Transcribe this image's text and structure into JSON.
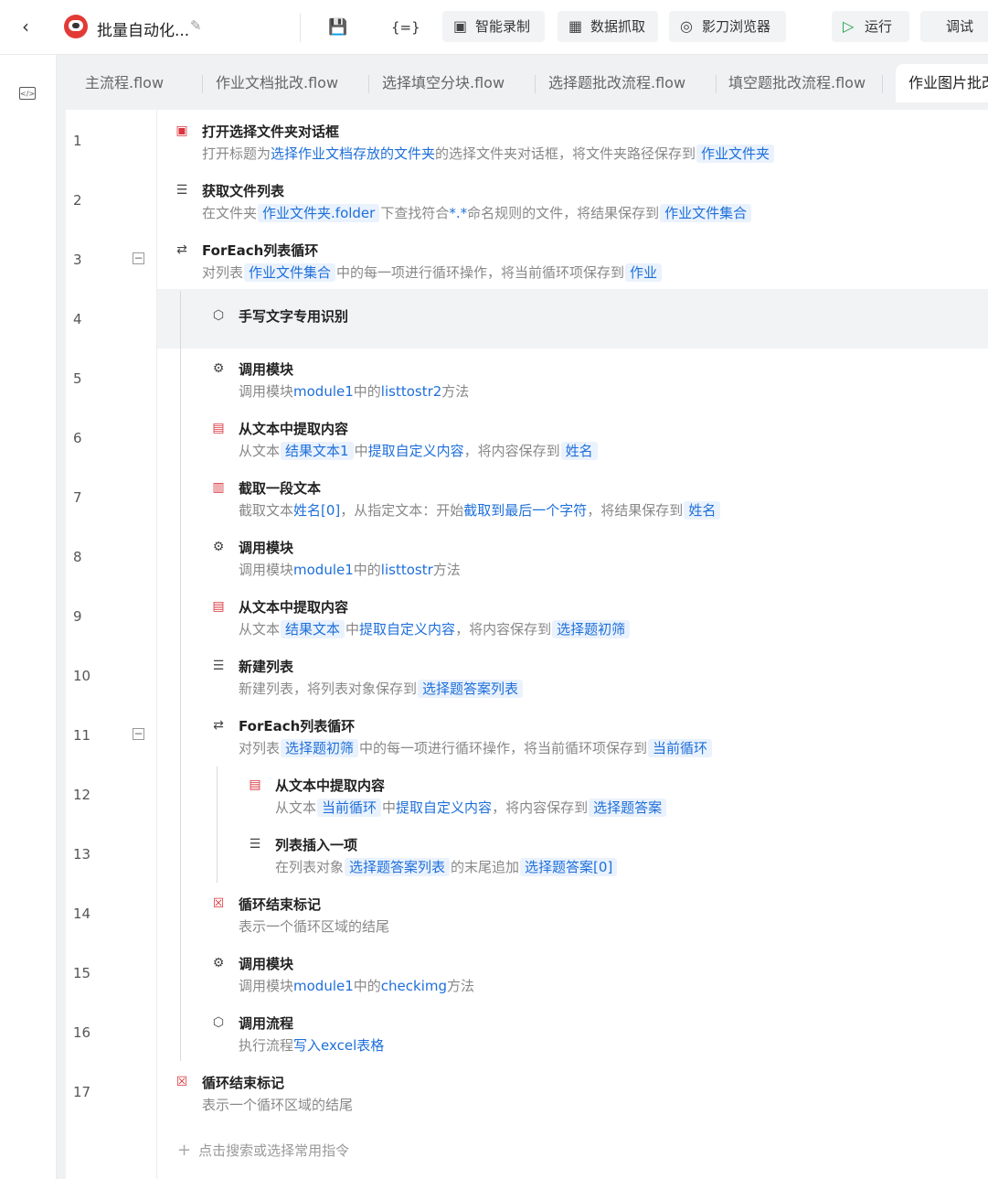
{
  "toolbar": {
    "back_icon": "chevron-left-icon",
    "project_title": "批量自动化...",
    "save_icon": "save-icon",
    "variables_icon": "variables-icon",
    "smart_record": "智能录制",
    "data_scrape": "数据抓取",
    "browser": "影刀浏览器",
    "run": "运行",
    "debug": "调试",
    "run_color": "#1aa34a"
  },
  "tabs": [
    "主流程.flow",
    "作业文档批改.flow",
    "选择填空分块.flow",
    "选择题批改流程.flow",
    "填空题批改流程.flow",
    "作业图片批改"
  ],
  "lines": [
    "1",
    "2",
    "3",
    "4",
    "5",
    "6",
    "7",
    "8",
    "9",
    "10",
    "11",
    "12",
    "13",
    "14",
    "15",
    "16",
    "17"
  ],
  "steps": [
    {
      "title": "打开选择文件夹对话框",
      "icon": "dialog-icon",
      "desc": [
        [
          "打开标题为",
          ""
        ],
        [
          "选择作业文档存放的文件夹",
          "kw"
        ],
        [
          "的选择文件夹对话框，将文件夹路径保存到",
          ""
        ],
        [
          "作业文件夹",
          "chip"
        ]
      ]
    },
    {
      "title": "获取文件列表",
      "icon": "file-list-icon",
      "desc": [
        [
          "在文件夹",
          ""
        ],
        [
          "作业文件夹.folder",
          "chip"
        ],
        [
          "下查找符合",
          ""
        ],
        [
          "*.*",
          "kw"
        ],
        [
          "命名规则的文件，将结果保存到",
          ""
        ],
        [
          "作业文件集合",
          "chip"
        ]
      ]
    },
    {
      "title": "ForEach列表循环",
      "icon": "loop-icon",
      "desc": [
        [
          "对列表",
          ""
        ],
        [
          "作业文件集合",
          "chip"
        ],
        [
          "中的每一项进行循环操作，将当前循环项保存到",
          ""
        ],
        [
          "作业",
          "chip"
        ]
      ]
    },
    {
      "title": "手写文字专用识别",
      "icon": "layers-icon",
      "desc": []
    },
    {
      "title": "调用模块",
      "icon": "module-icon",
      "desc": [
        [
          "调用模块",
          ""
        ],
        [
          "module1",
          "kw"
        ],
        [
          "中的",
          ""
        ],
        [
          "listtostr2",
          "kw"
        ],
        [
          "方法",
          ""
        ]
      ]
    },
    {
      "title": "从文本中提取内容",
      "icon": "extract-text-icon",
      "desc": [
        [
          "从文本",
          ""
        ],
        [
          "结果文本1",
          "chip"
        ],
        [
          "中",
          ""
        ],
        [
          "提取自定义内容",
          "kw"
        ],
        [
          "，将内容保存到",
          ""
        ],
        [
          "姓名",
          "chip"
        ]
      ]
    },
    {
      "title": "截取一段文本",
      "icon": "substring-icon",
      "desc": [
        [
          "截取文本",
          ""
        ],
        [
          "姓名[0]",
          "kw"
        ],
        [
          "，从指定文本：开始",
          ""
        ],
        [
          "截取到最后一个字符",
          "kw"
        ],
        [
          "，将结果保存到",
          ""
        ],
        [
          "姓名",
          "chip"
        ]
      ]
    },
    {
      "title": "调用模块",
      "icon": "module-icon",
      "desc": [
        [
          "调用模块",
          ""
        ],
        [
          "module1",
          "kw"
        ],
        [
          "中的",
          ""
        ],
        [
          "listtostr",
          "kw"
        ],
        [
          "方法",
          ""
        ]
      ]
    },
    {
      "title": "从文本中提取内容",
      "icon": "extract-text-icon",
      "desc": [
        [
          "从文本",
          ""
        ],
        [
          "结果文本",
          "chip"
        ],
        [
          "中",
          ""
        ],
        [
          "提取自定义内容",
          "kw"
        ],
        [
          "，将内容保存到",
          ""
        ],
        [
          "选择题初筛",
          "chip"
        ]
      ]
    },
    {
      "title": "新建列表",
      "icon": "new-list-icon",
      "desc": [
        [
          "新建列表，将列表对象保存到",
          ""
        ],
        [
          "选择题答案列表",
          "chip"
        ]
      ]
    },
    {
      "title": "ForEach列表循环",
      "icon": "loop-icon",
      "desc": [
        [
          "对列表",
          ""
        ],
        [
          "选择题初筛",
          "chip"
        ],
        [
          "中的每一项进行循环操作，将当前循环项保存到",
          ""
        ],
        [
          "当前循环",
          "chip"
        ]
      ]
    },
    {
      "title": "从文本中提取内容",
      "icon": "extract-text-icon",
      "desc": [
        [
          "从文本",
          ""
        ],
        [
          "当前循环",
          "chip"
        ],
        [
          "中",
          ""
        ],
        [
          "提取自定义内容",
          "kw"
        ],
        [
          "，将内容保存到",
          ""
        ],
        [
          "选择题答案",
          "chip"
        ]
      ]
    },
    {
      "title": "列表插入一项",
      "icon": "list-insert-icon",
      "desc": [
        [
          "在列表对象",
          ""
        ],
        [
          "选择题答案列表",
          "chip"
        ],
        [
          "的末尾追加",
          ""
        ],
        [
          "选择题答案[0]",
          "chip"
        ]
      ]
    },
    {
      "title": "循环结束标记",
      "icon": "loop-end-icon",
      "desc": [
        [
          "表示一个循环区域的结尾",
          ""
        ]
      ]
    },
    {
      "title": "调用模块",
      "icon": "module-icon",
      "desc": [
        [
          "调用模块",
          ""
        ],
        [
          "module1",
          "kw"
        ],
        [
          "中的",
          ""
        ],
        [
          "checkimg",
          "kw"
        ],
        [
          "方法",
          ""
        ]
      ]
    },
    {
      "title": "调用流程",
      "icon": "layers-icon",
      "desc": [
        [
          "执行流程",
          ""
        ],
        [
          "写入excel表格",
          "kw"
        ]
      ]
    },
    {
      "title": "循环结束标记",
      "icon": "loop-end-icon",
      "desc": [
        [
          "表示一个循环区域的结尾",
          ""
        ]
      ]
    }
  ],
  "add_hint": "点击搜索或选择常用指令",
  "colors": {
    "link": "#1e6fd9",
    "chip_bg": "#eaf2fd",
    "icon_red": "#d9363e"
  }
}
